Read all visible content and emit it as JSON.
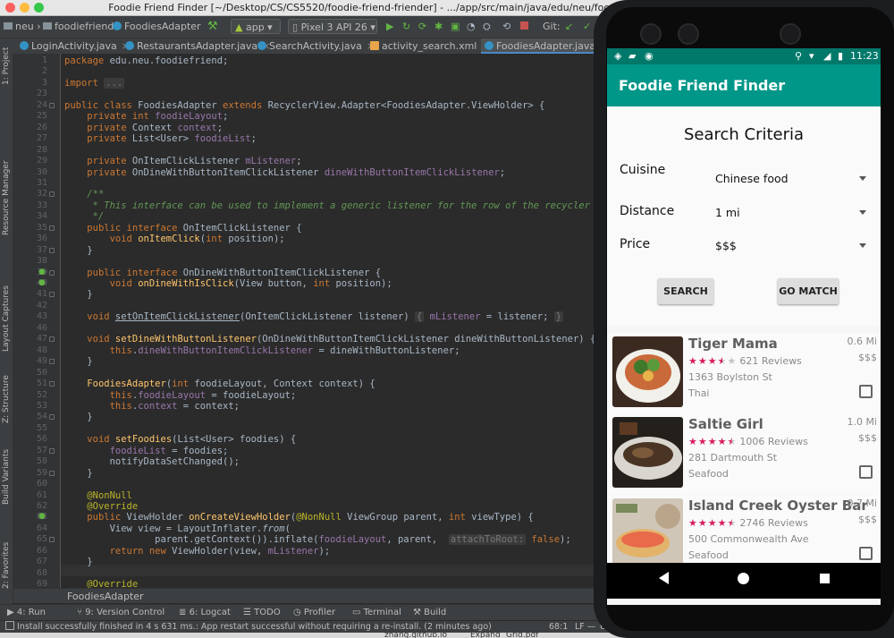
{
  "window": {
    "title": "Foodie Friend Finder [~/Desktop/CS/CS5520/foodie-friend-friender] - .../app/src/main/java/edu/neu/foodiefriend/FoodiesAdapter.java [app]"
  },
  "toolbar": {
    "breadcrumb": [
      "neu",
      "foodiefriend",
      "FoodiesAdapter"
    ],
    "module": "app",
    "device": "Pixel 3 API 26",
    "git_label": "Git:"
  },
  "tabs": [
    {
      "label": "LoginActivity.java",
      "type": "java",
      "active": false
    },
    {
      "label": "RestaurantsAdapter.java",
      "type": "java",
      "active": false
    },
    {
      "label": "SearchActivity.java",
      "type": "java",
      "active": false
    },
    {
      "label": "activity_search.xml",
      "type": "xml",
      "active": false
    },
    {
      "label": "FoodiesAdapter.java",
      "type": "java",
      "active": true
    }
  ],
  "left_tools": [
    "1: Project",
    "Resource Manager",
    "Layout Captures",
    "Z: Structure",
    "Build Variants",
    "2: Favorites"
  ],
  "code_lines": [
    {
      "n": "1",
      "html": "<span class='kw'>package</span> edu.neu.foodiefriend;"
    },
    {
      "n": "2",
      "html": ""
    },
    {
      "n": "3",
      "html": "<span class='kw'>import</span> <span class='hint'>...</span>"
    },
    {
      "n": "23",
      "html": ""
    },
    {
      "n": "24",
      "html": "<span class='kw'>public class</span> FoodiesAdapter <span class='kw'>extends</span> RecyclerView.Adapter&lt;FoodiesAdapter.ViewHolder&gt; {"
    },
    {
      "n": "25",
      "html": "    <span class='kw'>private int</span> <span class='fld'>foodieLayout</span>;"
    },
    {
      "n": "26",
      "html": "    <span class='kw'>private</span> Context <span class='fld'>context</span>;"
    },
    {
      "n": "27",
      "html": "    <span class='kw'>private</span> List&lt;User&gt; <span class='fld'>foodieList</span>;"
    },
    {
      "n": "28",
      "html": ""
    },
    {
      "n": "29",
      "html": "    <span class='kw'>private</span> OnItemClickListener <span class='fld'>mListener</span>;"
    },
    {
      "n": "30",
      "html": "    <span class='kw'>private</span> OnDineWithButtonItemClickListener <span class='fld'>dineWithButtonItemClickListener</span>;"
    },
    {
      "n": "31",
      "html": ""
    },
    {
      "n": "32",
      "html": "    <span class='cm'>/**</span>"
    },
    {
      "n": "33",
      "html": "<span class='cm'>     * This interface can be used to implement a generic listener for the row of the recycler view.</span>"
    },
    {
      "n": "34",
      "html": "<span class='cm'>     */</span>"
    },
    {
      "n": "35",
      "html": "    <span class='kw'>public interface</span> OnItemClickListener {"
    },
    {
      "n": "36",
      "html": "        <span class='kw'>void</span> <span class='fn'>onItemClick</span>(<span class='kw'>int</span> position);"
    },
    {
      "n": "37",
      "html": "    }"
    },
    {
      "n": "38",
      "html": ""
    },
    {
      "n": "39",
      "html": "    <span class='kw'>public interface</span> OnDineWithButtonItemClickListener {"
    },
    {
      "n": "40",
      "html": "        <span class='kw'>void</span> <span class='fn'>onDineWithIsClick</span>(View button, <span class='kw'>int</span> position);"
    },
    {
      "n": "41",
      "html": "    }"
    },
    {
      "n": "42",
      "html": ""
    },
    {
      "n": "43",
      "html": "    <span class='kw'>void</span> <span style='text-decoration:underline'>setOnItemClickListener</span>(OnItemClickListener listener) <span class='hint'>{</span> <span class='fld'>mListener</span> = listener; <span class='hint'>}</span>"
    },
    {
      "n": "46",
      "html": ""
    },
    {
      "n": "47",
      "html": "    <span class='kw'>void</span> <span class='fn'>setDineWithButtonListener</span>(OnDineWithButtonItemClickListener dineWithButtonListener) {"
    },
    {
      "n": "48",
      "html": "        <span class='kw'>this</span>.<span class='fld'>dineWithButtonItemClickListener</span> = dineWithButtonListener;"
    },
    {
      "n": "49",
      "html": "    }"
    },
    {
      "n": "50",
      "html": ""
    },
    {
      "n": "51",
      "html": "    <span class='fn'>FoodiesAdapter</span>(<span class='kw'>int</span> foodieLayout, Context context) {"
    },
    {
      "n": "52",
      "html": "        <span class='kw'>this</span>.<span class='fld'>foodieLayout</span> = foodieLayout;"
    },
    {
      "n": "53",
      "html": "        <span class='kw'>this</span>.<span class='fld'>context</span> = context;"
    },
    {
      "n": "54",
      "html": "    }"
    },
    {
      "n": "55",
      "html": ""
    },
    {
      "n": "56",
      "html": "    <span class='kw'>void</span> <span class='fn'>setFoodies</span>(List&lt;User&gt; foodies) {"
    },
    {
      "n": "57",
      "html": "        <span class='fld'>foodieList</span> = foodies;"
    },
    {
      "n": "58",
      "html": "        notifyDataSetChanged();"
    },
    {
      "n": "59",
      "html": "    }"
    },
    {
      "n": "60",
      "html": ""
    },
    {
      "n": "61",
      "html": "    <span class='an'>@NonNull</span>"
    },
    {
      "n": "62",
      "html": "    <span class='an'>@Override</span>"
    },
    {
      "n": "63",
      "html": "    <span class='kw'>public</span> ViewHolder <span class='fn'>onCreateViewHolder</span>(<span class='an'>@NonNull</span> ViewGroup parent, <span class='kw'>int</span> viewType) {"
    },
    {
      "n": "64",
      "html": "        View view = LayoutInflater.<i>from</i>("
    },
    {
      "n": "65",
      "html": "                parent.getContext()).inflate(<span class='fld'>foodieLayout</span>, parent,  <span class='hint'>attachToRoot:</span> <span class='kw'>false</span>);"
    },
    {
      "n": "66",
      "html": "        <span class='kw'>return new</span> ViewHolder(view, <span class='fld'>mListener</span>);"
    },
    {
      "n": "67",
      "html": "    }"
    },
    {
      "n": "68",
      "html": ""
    },
    {
      "n": "69",
      "html": "    <span class='an'>@Override</span>"
    }
  ],
  "code_breadcrumb": "FoodiesAdapter",
  "bottom_tools": [
    "4: Run",
    "9: Version Control",
    "6: Logcat",
    "TODO",
    "Profiler",
    "Terminal",
    "Build"
  ],
  "status": {
    "message": "Install successfully finished in 4 s 631 ms.: App restart successful without requiring a re-install. (2 minutes ago)",
    "position": "68:1",
    "line_ending": "LF —",
    "encoding": "U"
  },
  "dock": {
    "items": [
      "zhang.github.io",
      "Expand",
      "Grid.pdf"
    ]
  },
  "phone": {
    "status_time": "11:23",
    "app_title": "Foodie Friend Finder",
    "search": {
      "heading": "Search Criteria",
      "fields": [
        {
          "label": "Cuisine",
          "value": "Chinese food"
        },
        {
          "label": "Distance",
          "value": "1 mi"
        },
        {
          "label": "Price",
          "value": "$$$"
        }
      ],
      "search_button": "SEARCH",
      "go_match_button": "GO MATCH"
    },
    "results": [
      {
        "name": "Tiger Mama",
        "rating": 3.5,
        "reviews": "621 Reviews",
        "address": "1363 Boylston St",
        "category": "Thai",
        "distance": "0.6 Mi",
        "price": "$$$",
        "photo": "bowl-dish"
      },
      {
        "name": "Saltie Girl",
        "rating": 4.5,
        "reviews": "1006 Reviews",
        "address": "281 Dartmouth St",
        "category": "Seafood",
        "distance": "1.0 Mi",
        "price": "$$$",
        "photo": "fish-dish"
      },
      {
        "name": "Island Creek Oyster Bar",
        "rating": 4.5,
        "reviews": "2746 Reviews",
        "address": "500 Commonwealth Ave",
        "category": "Seafood",
        "distance": "0.7 Mi",
        "price": "$$$",
        "photo": "lobster-roll"
      }
    ]
  },
  "colors": {
    "accent": "#009688",
    "statusbar": "#00796b",
    "stars": "#d81b60",
    "ide_bg": "#2b2b2b"
  }
}
